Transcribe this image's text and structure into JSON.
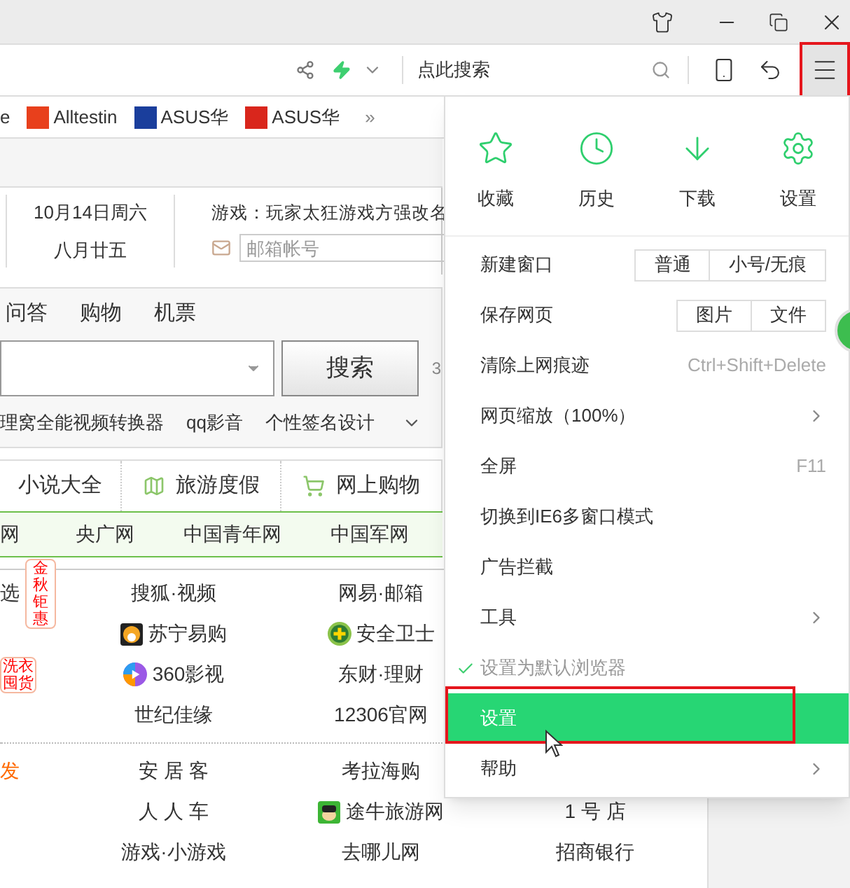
{
  "address_bar": {
    "search_placeholder": "点此搜索",
    "menu_outlined": true
  },
  "bookmarks": [
    {
      "label": "e"
    },
    {
      "label": "Alltestin",
      "color": "#e8401c"
    },
    {
      "label": "ASUS华",
      "color": "#1a3e9c"
    },
    {
      "label": "ASUS华",
      "color": "#d9261c"
    }
  ],
  "bookmarks_more": "»",
  "date": {
    "solar": "10月14日周六",
    "lunar": "八月廿五"
  },
  "news": {
    "headline": "游戏：玩家太狂游戏方强改名",
    "mail_placeholder": "邮箱帐号"
  },
  "search": {
    "tabs": [
      "问答",
      "购物",
      "机票"
    ],
    "button": "搜索",
    "side_text": "3"
  },
  "hot_links": [
    "理窝全能视频转换器",
    "qq影音",
    "个性签名设计"
  ],
  "categories": [
    {
      "label": "小说大全",
      "kind": "text"
    },
    {
      "label": "旅游度假",
      "kind": "map"
    },
    {
      "label": "网上购物",
      "kind": "cart"
    }
  ],
  "news_sites": [
    "网",
    "央广网",
    "中国青年网",
    "中国军网"
  ],
  "site_groups": [
    [
      {
        "col_1": {
          "text": "选",
          "badge": "金秋钜惠"
        },
        "col_2": {
          "text": "搜狐·视频"
        },
        "col_3": {
          "text": "网易·邮箱"
        }
      },
      {
        "col_2": {
          "text": "苏宁易购"
        },
        "col_3": {
          "text": "安全卫士"
        }
      },
      {
        "col_1": {
          "badge": "洗衣囤货"
        },
        "col_2": {
          "text": "360影视"
        },
        "col_3": {
          "text": "东财·理财"
        }
      },
      {
        "col_2": {
          "text": "世纪佳缘"
        },
        "col_3": {
          "text": "12306官网"
        }
      }
    ],
    [
      {
        "col_1": {
          "text": "发",
          "color": "#ff6a00"
        },
        "col_2": {
          "text": "安 居 客"
        },
        "col_3": {
          "text": "考拉海购"
        }
      },
      {
        "col_2": {
          "text": "人 人 车"
        },
        "col_3": {
          "text": "途牛旅游网"
        },
        "col_4": {
          "text": "1 号 店"
        }
      },
      {
        "col_2": {
          "text": "游戏·小游戏"
        },
        "col_3": {
          "text": "去哪儿网"
        },
        "col_4": {
          "text": "招商银行"
        }
      }
    ]
  ],
  "menu": {
    "shortcuts": [
      {
        "label": "收藏",
        "kind": "star"
      },
      {
        "label": "历史",
        "kind": "clock"
      },
      {
        "label": "下载",
        "kind": "download"
      },
      {
        "label": "设置",
        "kind": "gear"
      }
    ],
    "items": [
      {
        "label": "新建窗口",
        "kind": "buttons",
        "buttons": [
          "普通",
          "小号/无痕"
        ],
        "checked": false,
        "selected": false,
        "outlined": false
      },
      {
        "label": "保存网页",
        "kind": "buttons",
        "buttons": [
          "图片",
          "文件"
        ],
        "checked": false,
        "selected": false,
        "outlined": false
      },
      {
        "label": "清除上网痕迹",
        "kind": "shortcut",
        "shortcut": "Ctrl+Shift+Delete",
        "checked": false,
        "selected": false,
        "outlined": false
      },
      {
        "label": "网页缩放（100%）",
        "kind": "submenu",
        "checked": false,
        "selected": false,
        "outlined": false
      },
      {
        "label": "全屏",
        "kind": "shortcut",
        "shortcut": "F11",
        "checked": false,
        "selected": false,
        "outlined": false
      },
      {
        "label": "切换到IE6多窗口模式",
        "kind": "plain",
        "checked": false,
        "selected": false,
        "outlined": false
      },
      {
        "label": "广告拦截",
        "kind": "plain",
        "checked": false,
        "selected": false,
        "outlined": false
      },
      {
        "label": "工具",
        "kind": "submenu",
        "checked": false,
        "selected": false,
        "outlined": false
      },
      {
        "label": "设置为默认浏览器",
        "kind": "plain",
        "checked": true,
        "selected": false,
        "outlined": false
      },
      {
        "label": "设置",
        "kind": "plain",
        "checked": false,
        "selected": true,
        "outlined": true
      },
      {
        "label": "帮助",
        "kind": "submenu",
        "checked": false,
        "selected": false,
        "outlined": false
      }
    ]
  }
}
